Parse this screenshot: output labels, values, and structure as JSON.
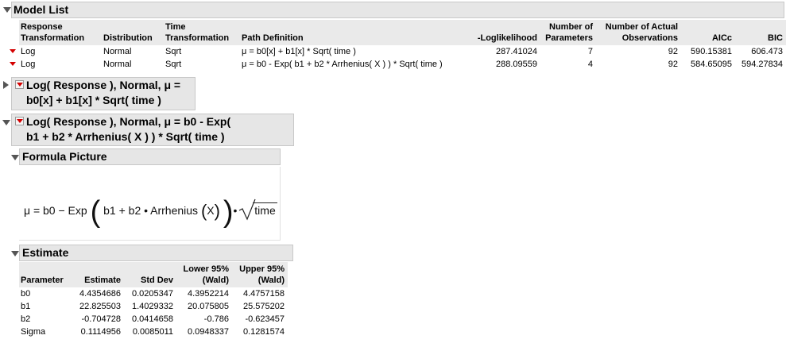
{
  "model_list": {
    "title": "Model List",
    "columns": [
      [
        "Response",
        "Transformation"
      ],
      [
        "",
        "Distribution"
      ],
      [
        "Time",
        "Transformation"
      ],
      [
        "",
        "Path Definition"
      ],
      [
        "",
        "-Loglikelihood"
      ],
      [
        "Number of",
        "Parameters"
      ],
      [
        "Number of Actual",
        "Observations"
      ],
      [
        "",
        "AICc"
      ],
      [
        "",
        "BIC"
      ]
    ],
    "rows": [
      [
        "Log",
        "Normal",
        "Sqrt",
        "μ = b0[x] + b1[x] * Sqrt( time )",
        "287.41024",
        "7",
        "92",
        "590.15381",
        "606.473"
      ],
      [
        "Log",
        "Normal",
        "Sqrt",
        "μ = b0 - Exp( b1 + b2 * Arrhenius( X ) ) * Sqrt( time )",
        "288.09559",
        "4",
        "92",
        "584.65095",
        "594.27834"
      ]
    ]
  },
  "report1": {
    "line1": "Log( Response ), Normal, μ =",
    "line2": "b0[x] + b1[x] * Sqrt( time )"
  },
  "report2": {
    "line1": "Log( Response ), Normal, μ = b0 - Exp(",
    "line2": "b1 + b2 * Arrhenius( X ) ) * Sqrt( time )"
  },
  "formula_picture": {
    "title": "Formula Picture",
    "lhs": "μ = b0 − Exp",
    "inner": "b1 + b2 • Arrhenius",
    "arg": "X",
    "dot": "•",
    "sqrt_arg": "time"
  },
  "estimate": {
    "title": "Estimate",
    "columns": [
      [
        "",
        "Parameter"
      ],
      [
        "",
        "Estimate"
      ],
      [
        "",
        "Std Dev"
      ],
      [
        "Lower 95%",
        "(Wald)"
      ],
      [
        "Upper 95%",
        "(Wald)"
      ]
    ],
    "rows": [
      [
        "b0",
        "4.4354686",
        "0.0205347",
        "4.3952214",
        "4.4757158"
      ],
      [
        "b1",
        "22.825503",
        "1.4029332",
        "20.075805",
        "25.575202"
      ],
      [
        "b2",
        "-0.704728",
        "0.0414658",
        "-0.786",
        "-0.623457"
      ],
      [
        "Sigma",
        "0.1114956",
        "0.0085011",
        "0.0948337",
        "0.1281574"
      ]
    ]
  }
}
